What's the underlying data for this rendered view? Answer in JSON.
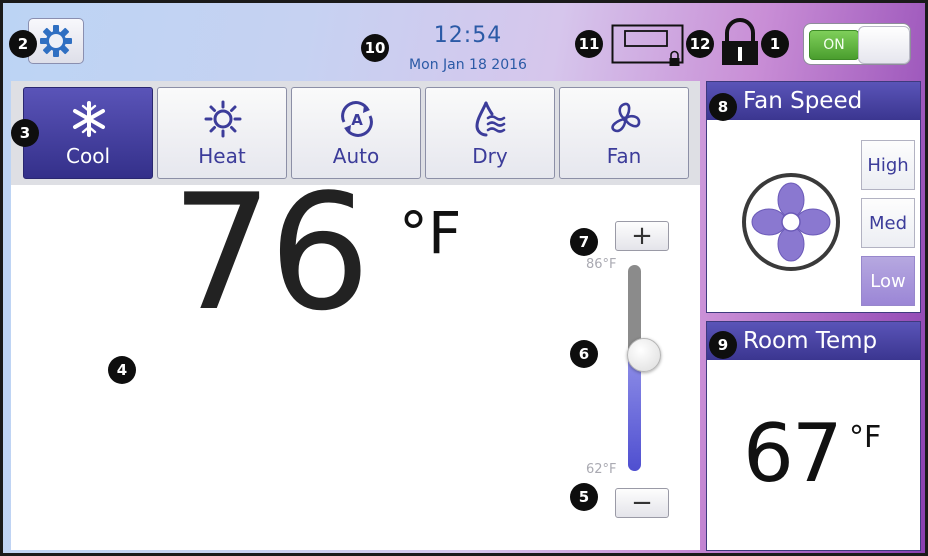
{
  "callouts": [
    "1",
    "2",
    "3",
    "4",
    "5",
    "6",
    "7",
    "8",
    "9",
    "10",
    "11",
    "12"
  ],
  "header": {
    "time": "12:54",
    "date": "Mon Jan 18 2016",
    "power": {
      "label": "ON",
      "state": "on"
    }
  },
  "modes": [
    {
      "label": "Cool",
      "icon": "snowflake-icon",
      "active": true
    },
    {
      "label": "Heat",
      "icon": "sun-icon",
      "active": false
    },
    {
      "label": "Auto",
      "icon": "auto-cycle-icon",
      "active": false
    },
    {
      "label": "Dry",
      "icon": "dry-drop-icon",
      "active": false
    },
    {
      "label": "Fan",
      "icon": "fan-icon",
      "active": false
    }
  ],
  "setpoint": {
    "value": "76",
    "unit": "°F",
    "plus_label": "+",
    "minus_label": "−",
    "max_label": "86°F",
    "min_label": "62°F",
    "slider_fraction": 0.57
  },
  "fan_speed": {
    "title": "Fan Speed",
    "options": [
      "High",
      "Med",
      "Low"
    ],
    "selected": "Low"
  },
  "room_temp": {
    "title": "Room Temp",
    "value": "67",
    "unit": "°F"
  },
  "colors": {
    "accent": "#3b3690",
    "power_on": "#5bb33a",
    "fan_blade": "#8a78d0"
  }
}
